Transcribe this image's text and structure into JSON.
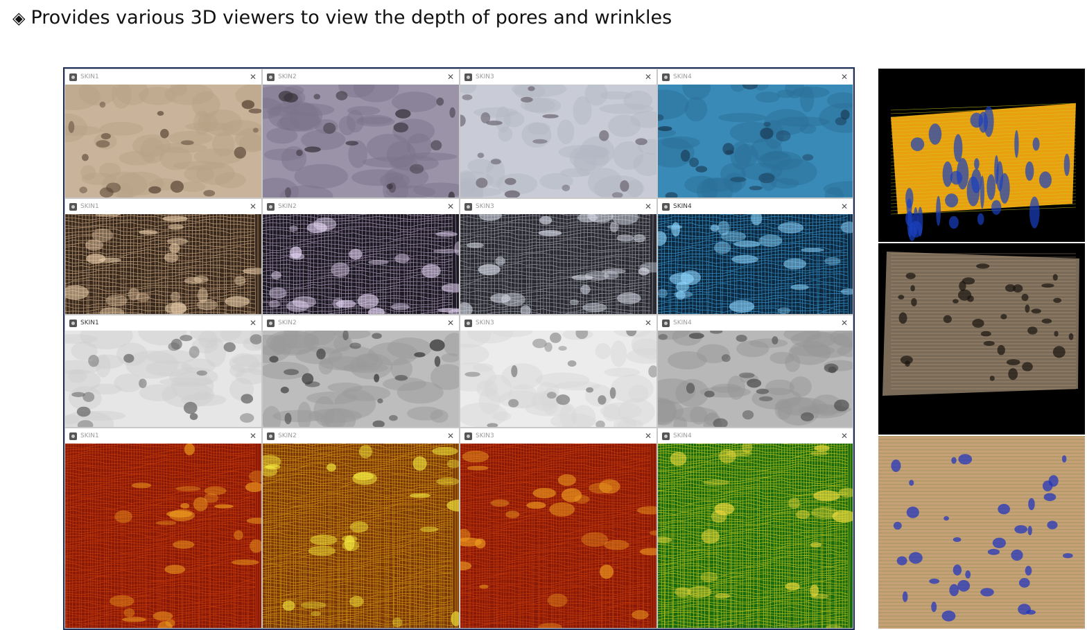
{
  "heading": {
    "bullet": "◈",
    "text": "Provides various 3D viewers to view the depth of pores and wrinkles"
  },
  "rows": [
    {
      "style": "textured",
      "windows": [
        {
          "title": "SKIN1",
          "active": false,
          "colors": [
            "#c9b49b",
            "#b8a185",
            "#5a4636"
          ]
        },
        {
          "title": "SKIN2",
          "active": false,
          "colors": [
            "#9b93a8",
            "#7c7489",
            "#3c3640"
          ]
        },
        {
          "title": "SKIN3",
          "active": false,
          "colors": [
            "#c9ccd6",
            "#b4b8c4",
            "#6a6470"
          ]
        },
        {
          "title": "SKIN4",
          "active": false,
          "colors": [
            "#3a8ab8",
            "#2a6f98",
            "#1a3d58"
          ]
        }
      ]
    },
    {
      "style": "wireframe",
      "windows": [
        {
          "title": "SKIN1",
          "active": false,
          "colors": [
            "#3a2a1e",
            "#d8b48c",
            "#f0d4b0"
          ]
        },
        {
          "title": "SKIN2",
          "active": false,
          "colors": [
            "#1e1a24",
            "#b8a8c8",
            "#f0e0ff"
          ]
        },
        {
          "title": "SKIN3",
          "active": false,
          "colors": [
            "#2a2a30",
            "#a8acb8",
            "#e0e4f0"
          ]
        },
        {
          "title": "SKIN4",
          "active": true,
          "colors": [
            "#0e2a40",
            "#3aa0e0",
            "#90d8ff"
          ]
        }
      ]
    },
    {
      "style": "shaded",
      "windows": [
        {
          "title": "SKIN1",
          "active": true,
          "colors": [
            "#e6e6e6",
            "#cfcfcf",
            "#6a6a6a"
          ]
        },
        {
          "title": "SKIN2",
          "active": false,
          "colors": [
            "#bdbdbd",
            "#9a9a9a",
            "#3a3a3a"
          ]
        },
        {
          "title": "SKIN3",
          "active": false,
          "colors": [
            "#ececec",
            "#d8d8d8",
            "#7a7a7a"
          ]
        },
        {
          "title": "SKIN4",
          "active": false,
          "colors": [
            "#b8b8b8",
            "#969696",
            "#4a4a4a"
          ]
        }
      ]
    },
    {
      "style": "heatwire",
      "windows": [
        {
          "title": "SKIN1",
          "active": false,
          "colors": [
            "#8a1a08",
            "#d0400a",
            "#f0a020"
          ]
        },
        {
          "title": "SKIN2",
          "active": false,
          "colors": [
            "#7a3a08",
            "#e0a010",
            "#f8f040"
          ]
        },
        {
          "title": "SKIN3",
          "active": false,
          "colors": [
            "#8a1a08",
            "#d0400a",
            "#f0a020"
          ]
        },
        {
          "title": "SKIN4",
          "active": false,
          "colors": [
            "#1a6a10",
            "#d0d020",
            "#f8e040"
          ]
        }
      ]
    }
  ],
  "side_panels": [
    {
      "name": "height-map-3d-view",
      "bg": "#000000",
      "colors": [
        "#e8a010",
        "#d0d020",
        "#1a40c0"
      ]
    },
    {
      "name": "pore-mesh-3d-view",
      "bg": "#000000",
      "colors": [
        "#7a6a58",
        "#c8b090",
        "#1a1410"
      ]
    },
    {
      "name": "topography-3d-view",
      "bg": "#2a5a18",
      "colors": [
        "#c8a078",
        "#5a8a30",
        "#1a30c0"
      ]
    }
  ]
}
